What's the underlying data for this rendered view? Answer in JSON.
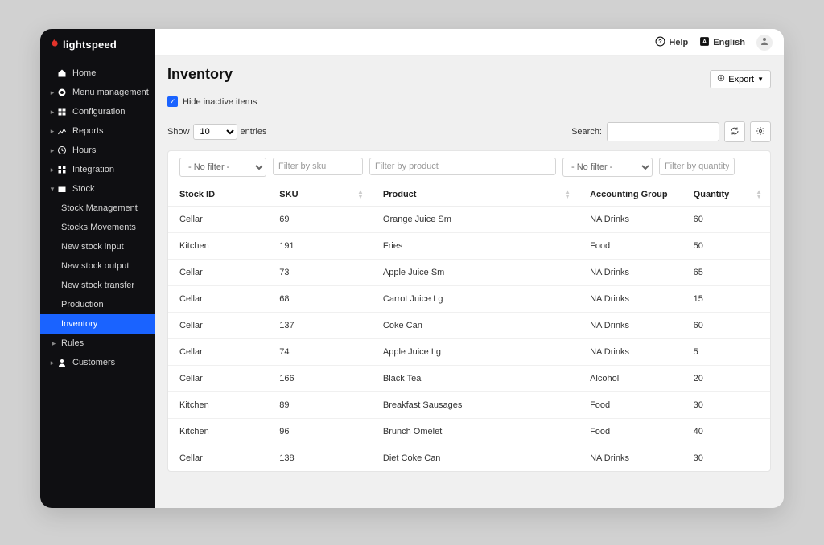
{
  "brand": "lightspeed",
  "topbar": {
    "help": "Help",
    "language": "English"
  },
  "sidebar": {
    "items": [
      {
        "label": "Home",
        "icon": "home",
        "expandable": false
      },
      {
        "label": "Menu management",
        "icon": "menu",
        "expandable": true
      },
      {
        "label": "Configuration",
        "icon": "config",
        "expandable": true
      },
      {
        "label": "Reports",
        "icon": "reports",
        "expandable": true
      },
      {
        "label": "Hours",
        "icon": "hours",
        "expandable": true
      },
      {
        "label": "Integration",
        "icon": "integration",
        "expandable": true
      },
      {
        "label": "Stock",
        "icon": "stock",
        "expandable": true,
        "expanded": true,
        "children": [
          {
            "label": "Stock Management"
          },
          {
            "label": "Stocks Movements"
          },
          {
            "label": "New stock input"
          },
          {
            "label": "New stock output"
          },
          {
            "label": "New stock transfer"
          },
          {
            "label": "Production"
          },
          {
            "label": "Inventory",
            "active": true
          },
          {
            "label": "Rules",
            "expandable": true
          }
        ]
      },
      {
        "label": "Customers",
        "icon": "customers",
        "expandable": true
      }
    ]
  },
  "page": {
    "title": "Inventory",
    "export_label": "Export",
    "hide_inactive_label": "Hide inactive items",
    "show_prefix": "Show",
    "show_suffix": "entries",
    "show_value": "10",
    "search_label": "Search:"
  },
  "filters": {
    "stock_no_filter": "- No filter -",
    "sku_placeholder": "Filter by sku",
    "product_placeholder": "Filter by product",
    "acct_no_filter": "- No filter -",
    "qty_placeholder": "Filter by quantity"
  },
  "columns": {
    "stock": "Stock ID",
    "sku": "SKU",
    "product": "Product",
    "acct": "Accounting Group",
    "qty": "Quantity"
  },
  "rows": [
    {
      "stock": "Cellar",
      "sku": "69",
      "product": "Orange Juice Sm",
      "acct": "NA Drinks",
      "qty": "60"
    },
    {
      "stock": "Kitchen",
      "sku": "191",
      "product": "Fries",
      "acct": "Food",
      "qty": "50"
    },
    {
      "stock": "Cellar",
      "sku": "73",
      "product": "Apple Juice Sm",
      "acct": "NA Drinks",
      "qty": "65"
    },
    {
      "stock": "Cellar",
      "sku": "68",
      "product": "Carrot Juice Lg",
      "acct": "NA Drinks",
      "qty": "15"
    },
    {
      "stock": "Cellar",
      "sku": "137",
      "product": "Coke Can",
      "acct": "NA Drinks",
      "qty": "60"
    },
    {
      "stock": "Cellar",
      "sku": "74",
      "product": "Apple Juice Lg",
      "acct": "NA Drinks",
      "qty": "5"
    },
    {
      "stock": "Cellar",
      "sku": "166",
      "product": "Black Tea",
      "acct": "Alcohol",
      "qty": "20"
    },
    {
      "stock": "Kitchen",
      "sku": "89",
      "product": "Breakfast Sausages",
      "acct": "Food",
      "qty": "30"
    },
    {
      "stock": "Kitchen",
      "sku": "96",
      "product": "Brunch Omelet",
      "acct": "Food",
      "qty": "40"
    },
    {
      "stock": "Cellar",
      "sku": "138",
      "product": "Diet Coke Can",
      "acct": "NA Drinks",
      "qty": "30"
    }
  ]
}
